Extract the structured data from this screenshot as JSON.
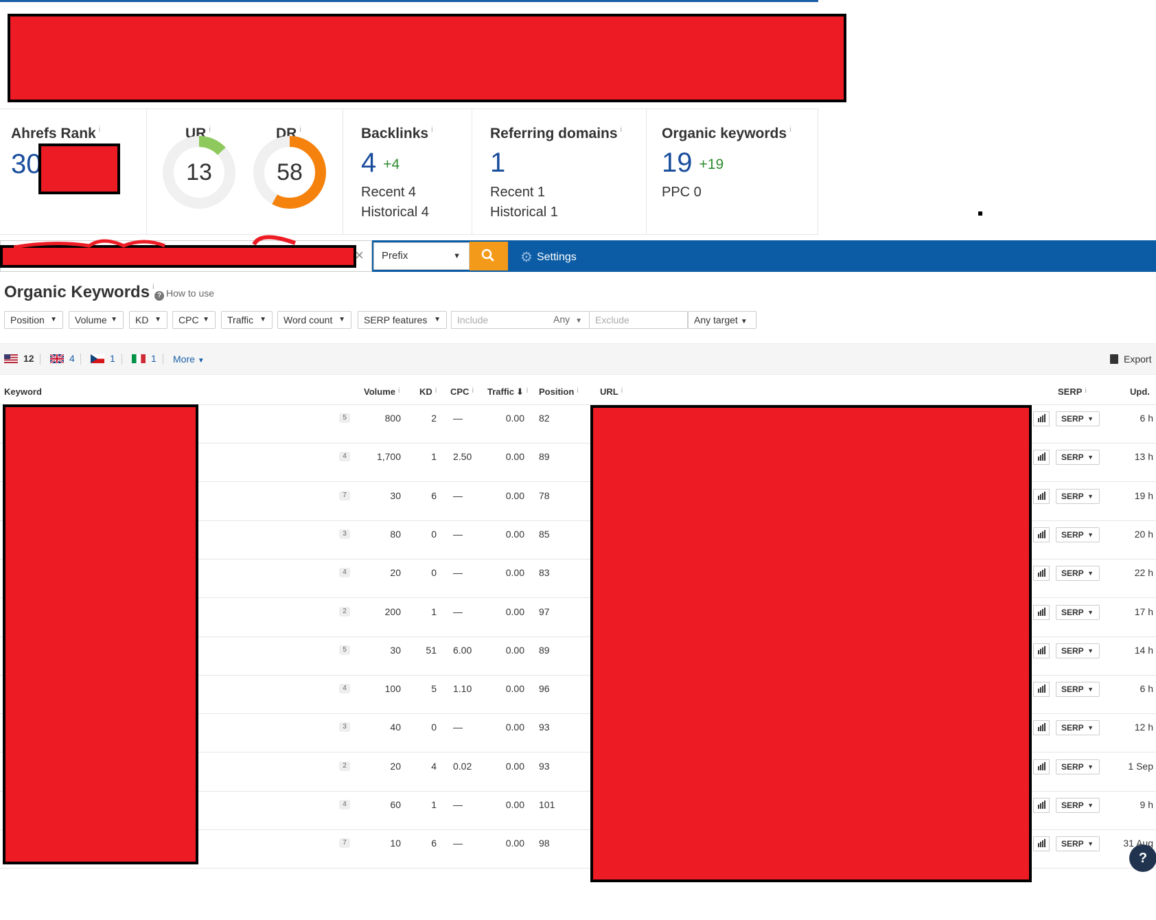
{
  "metrics": {
    "ahrefs_rank": {
      "title": "Ahrefs Rank",
      "info": "i",
      "value": "30"
    },
    "ur": {
      "title": "UR",
      "info": "i",
      "value": "13",
      "score": 13
    },
    "dr": {
      "title": "DR",
      "info": "i",
      "value": "58",
      "score": 58
    },
    "backlinks": {
      "title": "Backlinks",
      "info": "i",
      "value": "4",
      "delta": "+4",
      "recent": "Recent 4",
      "historical": "Historical 4"
    },
    "referring_domains": {
      "title": "Referring domains",
      "info": "i",
      "value": "1",
      "recent": "Recent 1",
      "historical": "Historical 1"
    },
    "organic_keywords": {
      "title": "Organic keywords",
      "info": "i",
      "value": "19",
      "delta": "+19",
      "ppc": "PPC 0"
    }
  },
  "search": {
    "clear": "×",
    "mode": "Prefix",
    "settings_label": "Settings"
  },
  "section": {
    "title": "Organic Keywords",
    "info": "i",
    "how_to_use": "How to use"
  },
  "filters": {
    "position": "Position",
    "volume": "Volume",
    "kd": "KD",
    "cpc": "CPC",
    "traffic": "Traffic",
    "word_count": "Word count",
    "serp_features": "SERP features",
    "include_placeholder": "Include",
    "any": "Any",
    "exclude_placeholder": "Exclude",
    "any_target": "Any target"
  },
  "countries": {
    "us": "12",
    "uk": "4",
    "cz": "1",
    "it": "1",
    "more": "More",
    "export": "Export"
  },
  "columns": {
    "keyword": "Keyword",
    "volume": "Volume",
    "kd": "KD",
    "cpc": "CPC",
    "traffic": "Traffic",
    "position": "Position",
    "url": "URL",
    "serp": "SERP",
    "updated": "Upd.",
    "info": "i"
  },
  "rows": [
    {
      "badge": "5",
      "volume": "800",
      "kd": "2",
      "cpc": "—",
      "traffic": "0.00",
      "position": "82",
      "serp": "SERP",
      "updated": "6 h"
    },
    {
      "badge": "4",
      "volume": "1,700",
      "kd": "1",
      "cpc": "2.50",
      "traffic": "0.00",
      "position": "89",
      "serp": "SERP",
      "updated": "13 h"
    },
    {
      "badge": "7",
      "volume": "30",
      "kd": "6",
      "cpc": "—",
      "traffic": "0.00",
      "position": "78",
      "serp": "SERP",
      "updated": "19 h"
    },
    {
      "badge": "3",
      "volume": "80",
      "kd": "0",
      "cpc": "—",
      "traffic": "0.00",
      "position": "85",
      "serp": "SERP",
      "updated": "20 h"
    },
    {
      "badge": "4",
      "volume": "20",
      "kd": "0",
      "cpc": "—",
      "traffic": "0.00",
      "position": "83",
      "serp": "SERP",
      "updated": "22 h"
    },
    {
      "badge": "2",
      "volume": "200",
      "kd": "1",
      "cpc": "—",
      "traffic": "0.00",
      "position": "97",
      "serp": "SERP",
      "updated": "17 h"
    },
    {
      "badge": "5",
      "volume": "30",
      "kd": "51",
      "cpc": "6.00",
      "traffic": "0.00",
      "position": "89",
      "serp": "SERP",
      "updated": "14 h"
    },
    {
      "badge": "4",
      "volume": "100",
      "kd": "5",
      "cpc": "1.10",
      "traffic": "0.00",
      "position": "96",
      "serp": "SERP",
      "updated": "6 h"
    },
    {
      "badge": "3",
      "volume": "40",
      "kd": "0",
      "cpc": "—",
      "traffic": "0.00",
      "position": "93",
      "serp": "SERP",
      "updated": "12 h"
    },
    {
      "badge": "2",
      "volume": "20",
      "kd": "4",
      "cpc": "0.02",
      "traffic": "0.00",
      "position": "93",
      "serp": "SERP",
      "updated": "1 Sep"
    },
    {
      "badge": "4",
      "volume": "60",
      "kd": "1",
      "cpc": "—",
      "traffic": "0.00",
      "position": "101",
      "serp": "SERP",
      "updated": "9 h"
    },
    {
      "badge": "7",
      "volume": "10",
      "kd": "6",
      "cpc": "—",
      "traffic": "0.00",
      "position": "98",
      "serp": "SERP",
      "updated": "31 Aug"
    }
  ],
  "help": "?",
  "colors": {
    "brand_blue": "#0b5ca4",
    "number_blue": "#1a4e9c",
    "orange": "#f39a1b",
    "delta_green": "#2e8b2e",
    "ur_gauge": "#8dc95d",
    "dr_gauge": "#f5820d",
    "redaction": "#ed1c24"
  }
}
